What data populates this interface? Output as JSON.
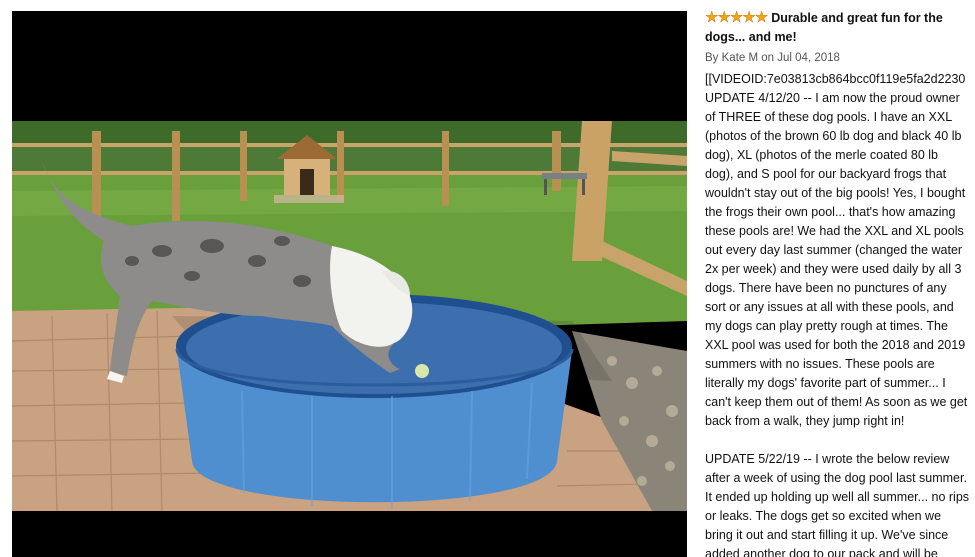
{
  "review": {
    "rating": 5,
    "rating_max": 5,
    "title": "Durable and great fun for the dogs... and me!",
    "author_prefix": "By",
    "author": "Kate M",
    "date_prefix": "on",
    "date": "Jul 04, 2018",
    "paragraphs": [
      {
        "lines": [
          "[[VIDEOID:7e03813cb864bcc0f119e5fa2d2230",
          "UPDATE 4/12/20 -- I am now the proud owner",
          "of THREE of these dog pools. I have an XXL",
          "(photos of the brown 60 lb dog and black 40 lb",
          "dog), XL (photos of the merle coated 80 lb",
          "dog), and S pool for our backyard frogs that",
          "wouldn't stay out of the big pools! Yes, I bought",
          "the frogs their own pool... that's how amazing",
          "these pools are! We had the XXL and XL pools",
          "out every day last summer (changed the water",
          "2x per week) and they were used daily by all 3",
          "dogs. There have been no punctures of any",
          "sort or any issues at all with these pools, and",
          "my dogs can play pretty rough at times. The",
          "XXL pool was used for both the 2018 and 2019",
          "summers with no issues. These pools are",
          "literally my dogs' favorite part of summer... I",
          "can't keep them out of them! As soon as we get",
          "back from a walk, they jump right in!"
        ]
      },
      {
        "lines": [
          "UPDATE 5/22/19 -- I wrote the below review",
          "after a week of using the dog pool last summer.",
          "It ended up holding up well all summer... no rips",
          "or leaks. The dogs get so excited when we",
          "bring it out and start filling it up. We've since",
          "added another dog to our pack and will be"
        ]
      }
    ]
  },
  "colors": {
    "star": "#f2a517",
    "viewer_bg": "#000000",
    "pool": "#4f8fd0"
  },
  "icons": {
    "star": "star-icon"
  }
}
